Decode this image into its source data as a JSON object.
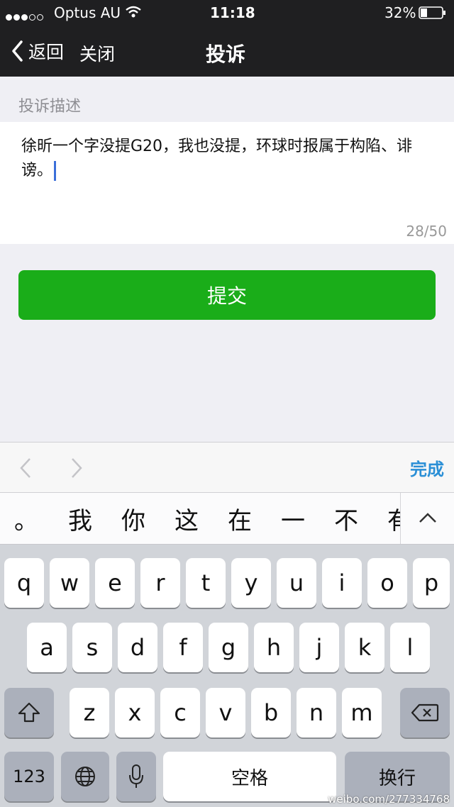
{
  "status": {
    "carrier": "Optus AU",
    "time": "11:18",
    "battery": "32%"
  },
  "nav": {
    "back_label": "返回",
    "close_label": "关闭",
    "title": "投诉"
  },
  "form": {
    "section_label": "投诉描述",
    "text": "徐昕一个字没提G20，我也没提，环球时报属于构陷、诽谤。",
    "counter": "28/50",
    "submit_label": "提交"
  },
  "accessory": {
    "done_label": "完成"
  },
  "candidates": [
    "。",
    "我",
    "你",
    "这",
    "在",
    "一",
    "不",
    "有"
  ],
  "keyboard": {
    "row1": [
      "q",
      "w",
      "e",
      "r",
      "t",
      "y",
      "u",
      "i",
      "o",
      "p"
    ],
    "row2": [
      "a",
      "s",
      "d",
      "f",
      "g",
      "h",
      "j",
      "k",
      "l"
    ],
    "row3": [
      "z",
      "x",
      "c",
      "v",
      "b",
      "n",
      "m"
    ],
    "numbers_label": "123",
    "space_label": "空格",
    "return_label": "换行"
  },
  "watermark": "weibo.com/277334768",
  "icons": [
    "signal-dots-icon",
    "wifi-icon",
    "battery-icon",
    "back-chevron-icon",
    "prev-arrow-icon",
    "next-arrow-icon",
    "collapse-chevron-icon",
    "shift-icon",
    "delete-icon",
    "globe-icon",
    "microphone-icon"
  ]
}
